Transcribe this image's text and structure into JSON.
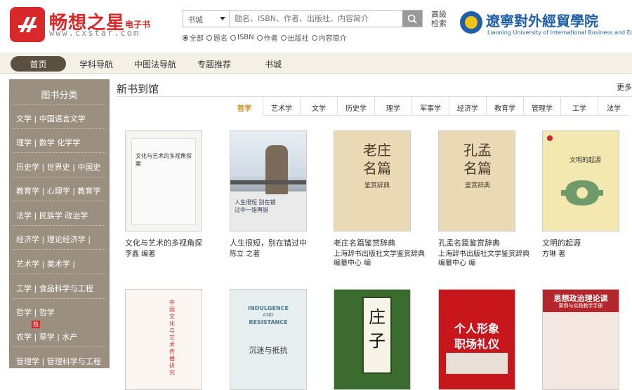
{
  "header": {
    "brand": "畅想之星",
    "brand_sub": "电子书",
    "brand_url": "www.cxstar.com",
    "search": {
      "select_value": "书城",
      "placeholder": "题名、ISBN、作者、出版社、内容简介"
    },
    "advanced_search": "高级检索",
    "radios": [
      {
        "label": "全部",
        "checked": true
      },
      {
        "label": "题名",
        "checked": false
      },
      {
        "label": "ISBN",
        "checked": false
      },
      {
        "label": "作者",
        "checked": false
      },
      {
        "label": "出版社",
        "checked": false
      },
      {
        "label": "内容简介",
        "checked": false
      }
    ],
    "university_name": "遼寧對外經貿學院",
    "university_en": "Liaoning University of International Business and Economics"
  },
  "nav": {
    "items": [
      "首页",
      "学科导航",
      "中图法导航",
      "专题推荐",
      "书城"
    ]
  },
  "sidebar": {
    "title": "图书分类",
    "items": [
      "文学 | 中国语言文学",
      "理学 | 数学 化学学",
      "历史学 | 世界史 | 中国史",
      "教育学 | 心理学 | 教育学",
      "法学 | 民族学 政治学",
      "经济学 | 理论经济学 |",
      "艺术学 | 美术学 |",
      "工学 | 食品科学与工程",
      "哲学 | 哲学",
      "农学 | 草学 | 水产",
      "管理学 | 管理科学与工程"
    ],
    "hot_badge": "热"
  },
  "main": {
    "title": "新书到馆",
    "more": "更多",
    "tabs": [
      "哲学",
      "艺术学",
      "文学",
      "历史学",
      "理学",
      "军事学",
      "经济学",
      "教育学",
      "管理学",
      "工学",
      "法学"
    ],
    "books_row1": [
      {
        "title": "文化与艺术的多视角探",
        "author": "李鑫 编著"
      },
      {
        "title": "人生很短，别在错过中",
        "author": "陈立 之著"
      },
      {
        "title": "老庄名篇鉴赏辞典",
        "author": "上海辞书出版社文学鉴赏辞典编纂中心 编"
      },
      {
        "title": "孔孟名篇鉴赏辞典",
        "author": "上海辞书出版社文学鉴赏辞典编纂中心 编"
      },
      {
        "title": "文明的起源",
        "author": "方琳 著"
      }
    ],
    "covers": {
      "b1_title": "文化与艺术的多视角探索",
      "b2_title": "人生很短 别在错过中一错再错",
      "b3_title": "老庄名篇",
      "b3_sub": "鉴赏辞典",
      "b4_title": "孔孟名篇",
      "b4_sub": "鉴赏辞典",
      "b5_title": "文明的起源",
      "b6_title": "中国文化与艺术传播研究",
      "b7_title_en1": "INDULGENCE",
      "b7_title_en2": "AND",
      "b7_title_en3": "RESISTANCE",
      "b7_title": "沉迷与抵抗",
      "b8_title": "庄子",
      "b9_title1": "个人形象",
      "b9_title2": "职场礼仪",
      "b10_title1": "思想政治理论课",
      "b10_title2": "案例与实践教学手册"
    }
  }
}
